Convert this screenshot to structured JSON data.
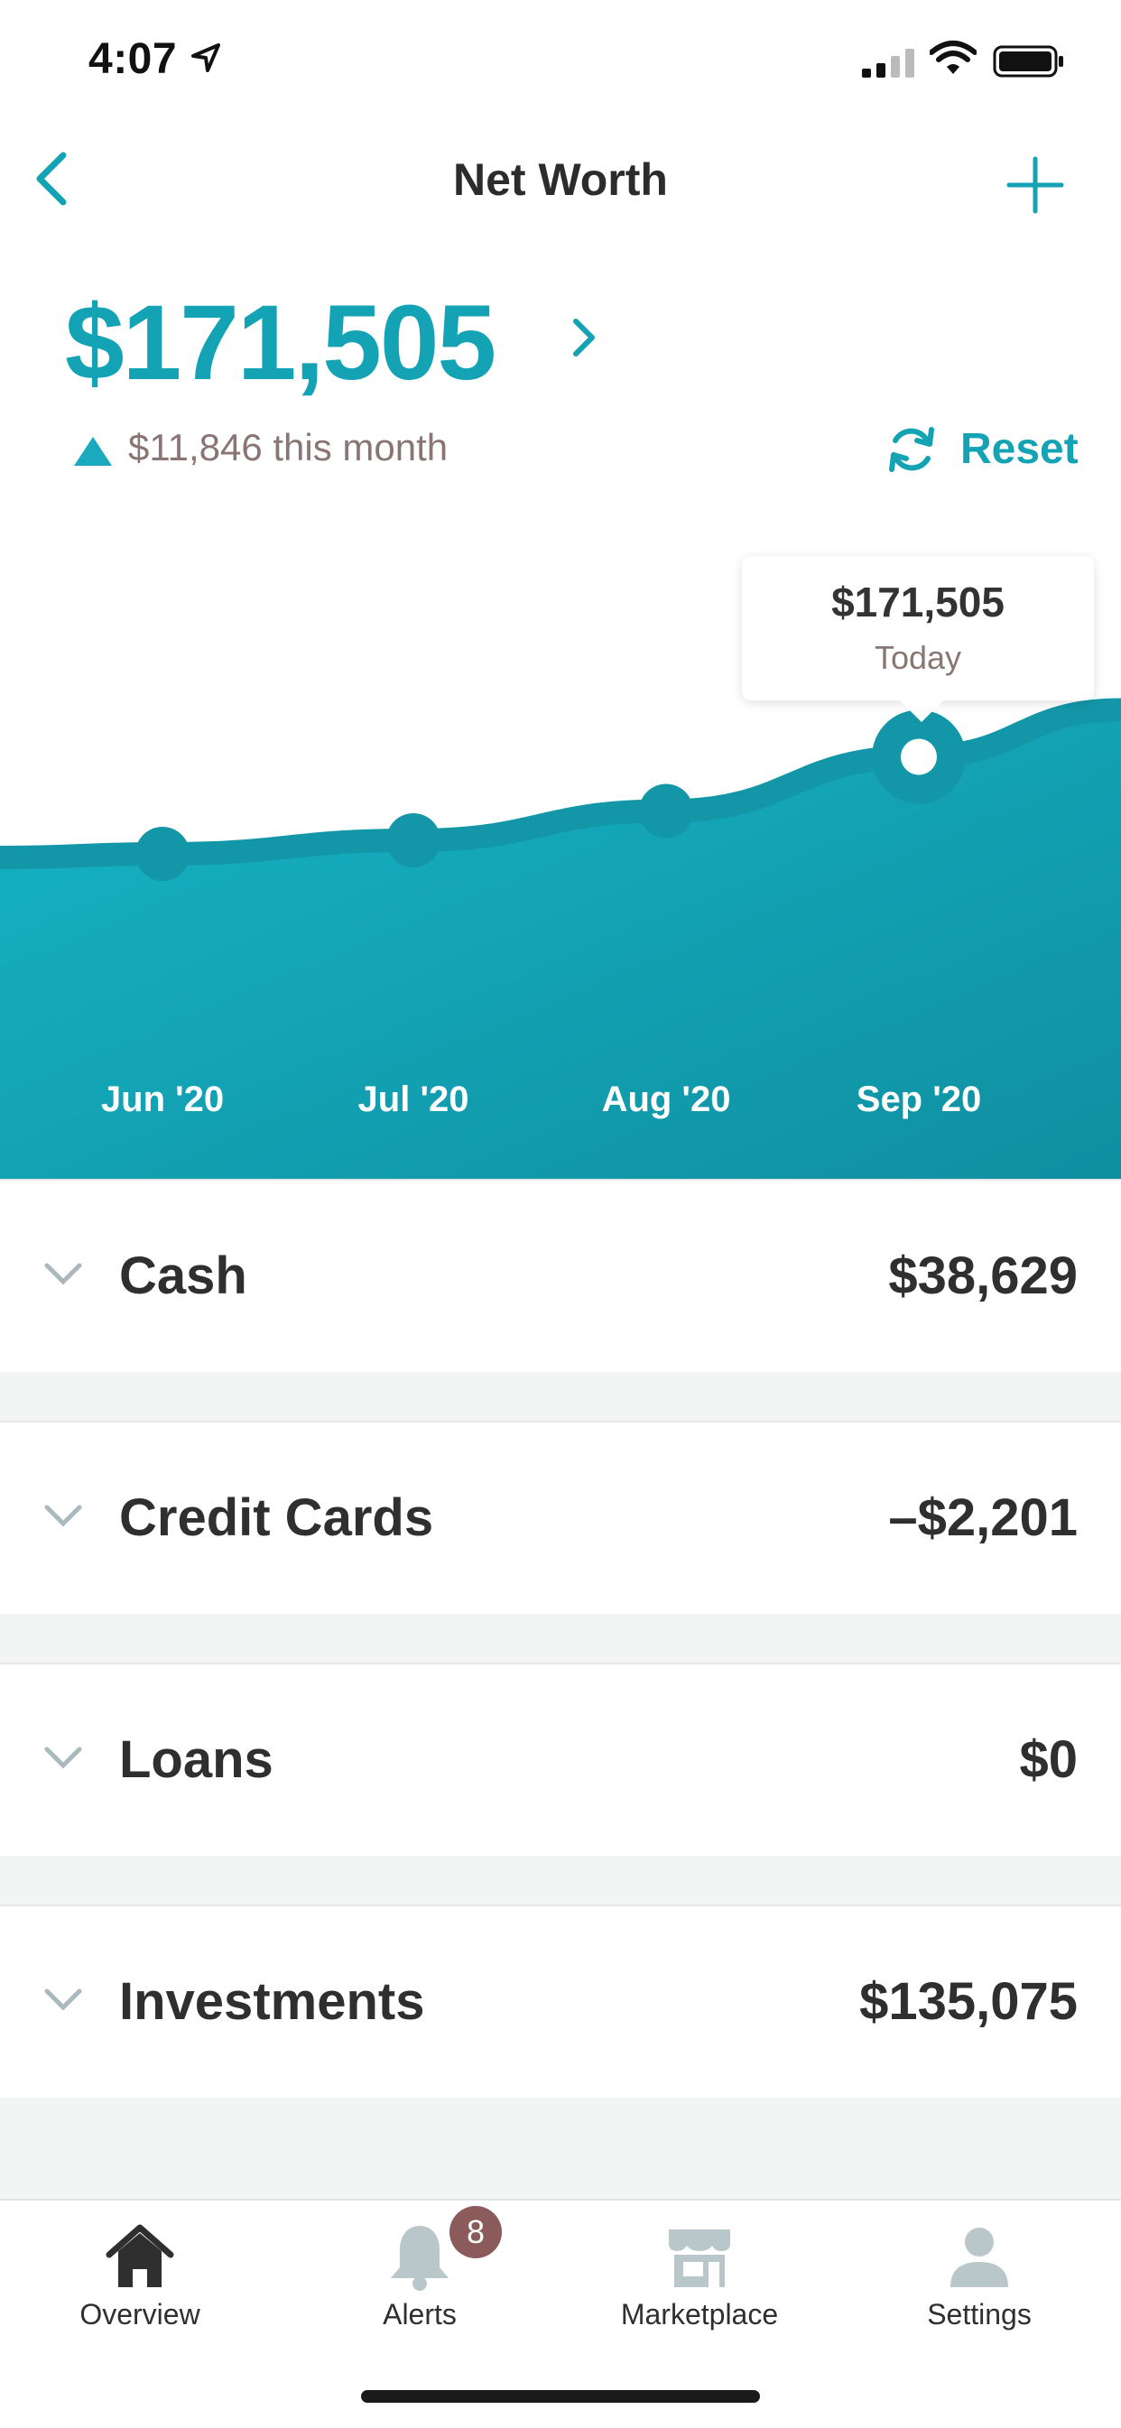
{
  "status_bar": {
    "time": "4:07"
  },
  "nav": {
    "title": "Net Worth"
  },
  "summary": {
    "total": "$171,505",
    "change_text": "$11,846 this month",
    "reset_label": "Reset"
  },
  "tooltip": {
    "value": "$171,505",
    "label": "Today"
  },
  "chart_data": {
    "type": "area",
    "categories": [
      "Jun '20",
      "Jul '20",
      "Aug '20",
      "Sep '20"
    ],
    "series": [
      {
        "values": [
          150000,
          153000,
          159500,
          171505
        ]
      }
    ],
    "highlight_index": 3
  },
  "categories": [
    {
      "name": "Cash",
      "value": "$38,629"
    },
    {
      "name": "Credit Cards",
      "value": "–$2,201"
    },
    {
      "name": "Loans",
      "value": "$0"
    },
    {
      "name": "Investments",
      "value": "$135,075"
    }
  ],
  "tabs": [
    {
      "label": "Overview",
      "icon": "home-icon"
    },
    {
      "label": "Alerts",
      "icon": "bell-icon"
    },
    {
      "label": "Marketplace",
      "icon": "store-icon"
    },
    {
      "label": "Settings",
      "icon": "user-icon"
    }
  ],
  "alerts_badge": "8",
  "colors": {
    "accent": "#14a2b5",
    "muted_text": "#8a7575",
    "badge": "#8b5a5a"
  }
}
